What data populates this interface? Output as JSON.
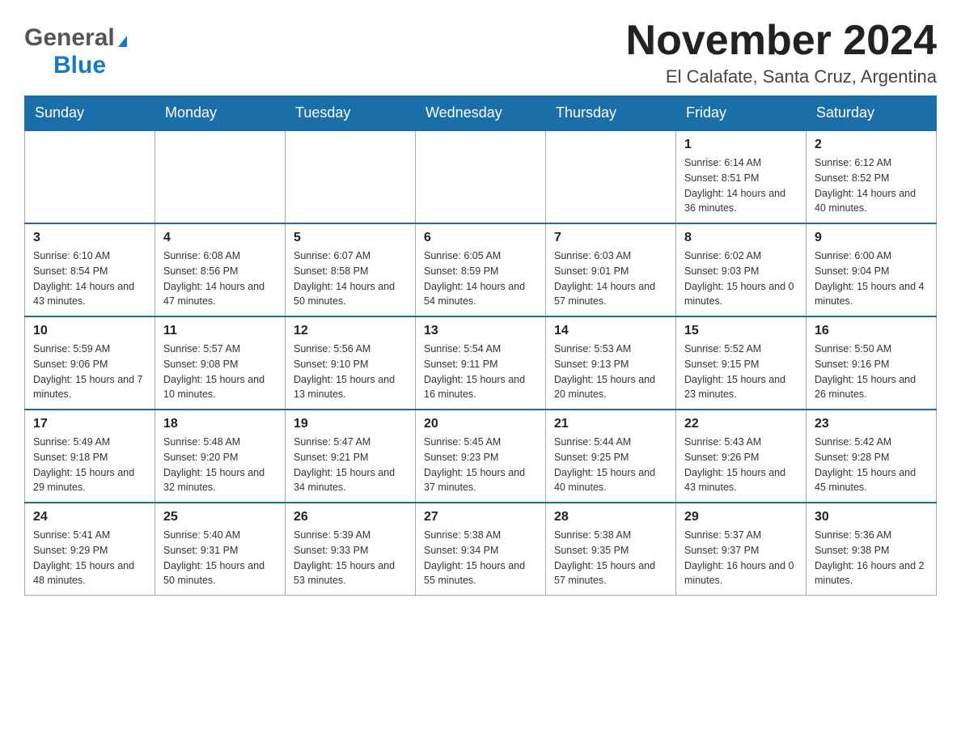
{
  "logo": {
    "general": "General",
    "triangle_symbol": "▶",
    "blue": "Blue"
  },
  "header": {
    "month_year": "November 2024",
    "location": "El Calafate, Santa Cruz, Argentina"
  },
  "days_of_week": [
    "Sunday",
    "Monday",
    "Tuesday",
    "Wednesday",
    "Thursday",
    "Friday",
    "Saturday"
  ],
  "weeks": [
    {
      "days": [
        {
          "number": "",
          "info": ""
        },
        {
          "number": "",
          "info": ""
        },
        {
          "number": "",
          "info": ""
        },
        {
          "number": "",
          "info": ""
        },
        {
          "number": "",
          "info": ""
        },
        {
          "number": "1",
          "info": "Sunrise: 6:14 AM\nSunset: 8:51 PM\nDaylight: 14 hours and 36 minutes."
        },
        {
          "number": "2",
          "info": "Sunrise: 6:12 AM\nSunset: 8:52 PM\nDaylight: 14 hours and 40 minutes."
        }
      ]
    },
    {
      "days": [
        {
          "number": "3",
          "info": "Sunrise: 6:10 AM\nSunset: 8:54 PM\nDaylight: 14 hours and 43 minutes."
        },
        {
          "number": "4",
          "info": "Sunrise: 6:08 AM\nSunset: 8:56 PM\nDaylight: 14 hours and 47 minutes."
        },
        {
          "number": "5",
          "info": "Sunrise: 6:07 AM\nSunset: 8:58 PM\nDaylight: 14 hours and 50 minutes."
        },
        {
          "number": "6",
          "info": "Sunrise: 6:05 AM\nSunset: 8:59 PM\nDaylight: 14 hours and 54 minutes."
        },
        {
          "number": "7",
          "info": "Sunrise: 6:03 AM\nSunset: 9:01 PM\nDaylight: 14 hours and 57 minutes."
        },
        {
          "number": "8",
          "info": "Sunrise: 6:02 AM\nSunset: 9:03 PM\nDaylight: 15 hours and 0 minutes."
        },
        {
          "number": "9",
          "info": "Sunrise: 6:00 AM\nSunset: 9:04 PM\nDaylight: 15 hours and 4 minutes."
        }
      ]
    },
    {
      "days": [
        {
          "number": "10",
          "info": "Sunrise: 5:59 AM\nSunset: 9:06 PM\nDaylight: 15 hours and 7 minutes."
        },
        {
          "number": "11",
          "info": "Sunrise: 5:57 AM\nSunset: 9:08 PM\nDaylight: 15 hours and 10 minutes."
        },
        {
          "number": "12",
          "info": "Sunrise: 5:56 AM\nSunset: 9:10 PM\nDaylight: 15 hours and 13 minutes."
        },
        {
          "number": "13",
          "info": "Sunrise: 5:54 AM\nSunset: 9:11 PM\nDaylight: 15 hours and 16 minutes."
        },
        {
          "number": "14",
          "info": "Sunrise: 5:53 AM\nSunset: 9:13 PM\nDaylight: 15 hours and 20 minutes."
        },
        {
          "number": "15",
          "info": "Sunrise: 5:52 AM\nSunset: 9:15 PM\nDaylight: 15 hours and 23 minutes."
        },
        {
          "number": "16",
          "info": "Sunrise: 5:50 AM\nSunset: 9:16 PM\nDaylight: 15 hours and 26 minutes."
        }
      ]
    },
    {
      "days": [
        {
          "number": "17",
          "info": "Sunrise: 5:49 AM\nSunset: 9:18 PM\nDaylight: 15 hours and 29 minutes."
        },
        {
          "number": "18",
          "info": "Sunrise: 5:48 AM\nSunset: 9:20 PM\nDaylight: 15 hours and 32 minutes."
        },
        {
          "number": "19",
          "info": "Sunrise: 5:47 AM\nSunset: 9:21 PM\nDaylight: 15 hours and 34 minutes."
        },
        {
          "number": "20",
          "info": "Sunrise: 5:45 AM\nSunset: 9:23 PM\nDaylight: 15 hours and 37 minutes."
        },
        {
          "number": "21",
          "info": "Sunrise: 5:44 AM\nSunset: 9:25 PM\nDaylight: 15 hours and 40 minutes."
        },
        {
          "number": "22",
          "info": "Sunrise: 5:43 AM\nSunset: 9:26 PM\nDaylight: 15 hours and 43 minutes."
        },
        {
          "number": "23",
          "info": "Sunrise: 5:42 AM\nSunset: 9:28 PM\nDaylight: 15 hours and 45 minutes."
        }
      ]
    },
    {
      "days": [
        {
          "number": "24",
          "info": "Sunrise: 5:41 AM\nSunset: 9:29 PM\nDaylight: 15 hours and 48 minutes."
        },
        {
          "number": "25",
          "info": "Sunrise: 5:40 AM\nSunset: 9:31 PM\nDaylight: 15 hours and 50 minutes."
        },
        {
          "number": "26",
          "info": "Sunrise: 5:39 AM\nSunset: 9:33 PM\nDaylight: 15 hours and 53 minutes."
        },
        {
          "number": "27",
          "info": "Sunrise: 5:38 AM\nSunset: 9:34 PM\nDaylight: 15 hours and 55 minutes."
        },
        {
          "number": "28",
          "info": "Sunrise: 5:38 AM\nSunset: 9:35 PM\nDaylight: 15 hours and 57 minutes."
        },
        {
          "number": "29",
          "info": "Sunrise: 5:37 AM\nSunset: 9:37 PM\nDaylight: 16 hours and 0 minutes."
        },
        {
          "number": "30",
          "info": "Sunrise: 5:36 AM\nSunset: 9:38 PM\nDaylight: 16 hours and 2 minutes."
        }
      ]
    }
  ]
}
